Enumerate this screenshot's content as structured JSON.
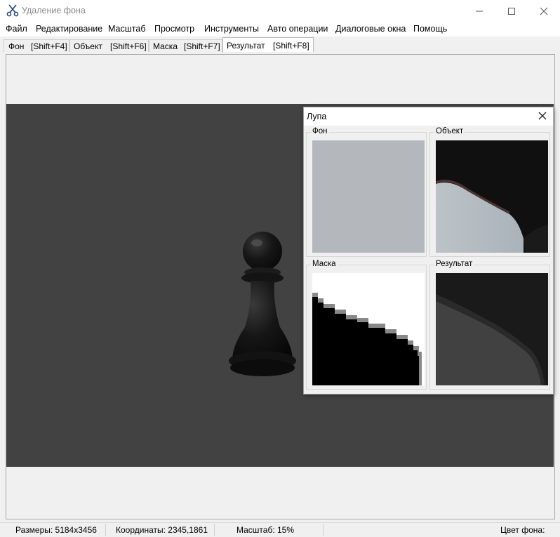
{
  "window": {
    "title": "Удаление фона"
  },
  "menu": [
    "Файл",
    "Редактирование",
    "Масштаб",
    "Просмотр",
    "Инструменты",
    "Авто операции",
    "Диалоговые окна",
    "Помощь"
  ],
  "tabs": [
    {
      "label": "Фон",
      "shortcut": "[Shift+F4]",
      "active": false
    },
    {
      "label": "Объект",
      "shortcut": "[Shift+F6]",
      "active": false
    },
    {
      "label": "Маска",
      "shortcut": "[Shift+F7]",
      "active": false
    },
    {
      "label": "Результат",
      "shortcut": "[Shift+F8]",
      "active": true
    }
  ],
  "loupe": {
    "title": "Лупа",
    "panels": [
      "Фон",
      "Объект",
      "Маска",
      "Результат"
    ]
  },
  "status": {
    "size": "Размеры: 5184x3456",
    "coords": "Координаты: 2345,1861",
    "zoom": "Масштаб: 15%",
    "bg_color": "Цвет фона: "
  },
  "colors": {
    "canvas_bg": "#424242",
    "window_bg": "#f0f0f0",
    "pawn": "#151515"
  },
  "icons": {
    "app": "scissors-icon",
    "minimize": "minimize-icon",
    "maximize": "maximize-icon",
    "close": "close-icon",
    "loupe_close": "close-icon"
  }
}
